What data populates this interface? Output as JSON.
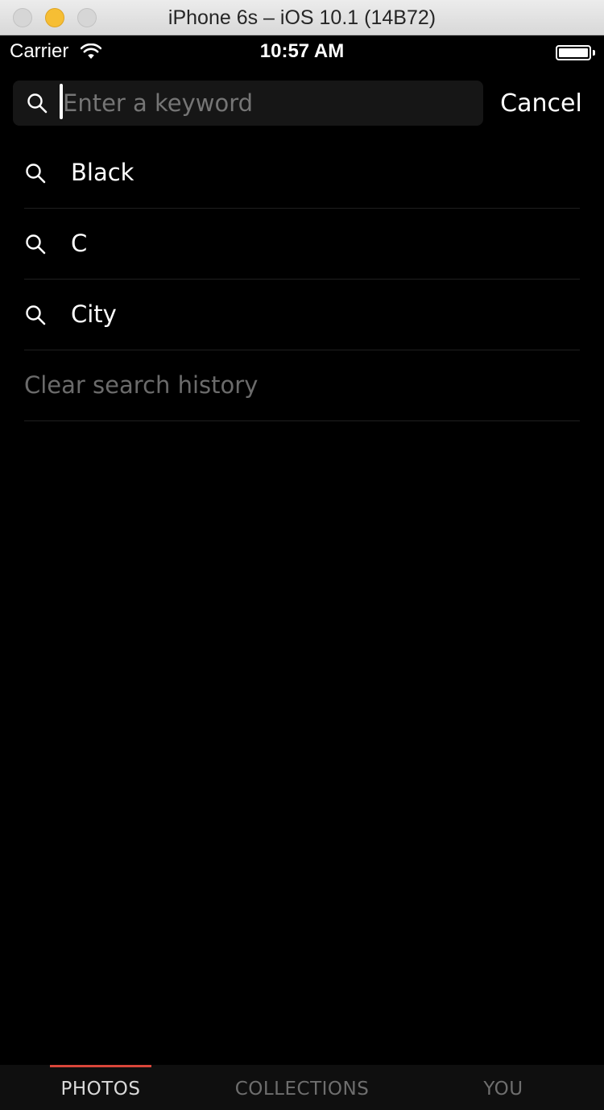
{
  "window": {
    "title": "iPhone 6s – iOS 10.1 (14B72)"
  },
  "status_bar": {
    "carrier": "Carrier",
    "time": "10:57 AM",
    "wifi_icon": "wifi-icon",
    "battery_icon": "battery-icon",
    "battery_level": 1.0
  },
  "search": {
    "placeholder": "Enter a keyword",
    "value": "",
    "icon": "search-icon",
    "cancel_label": "Cancel"
  },
  "history": {
    "items": [
      {
        "label": "Black",
        "icon": "search-icon"
      },
      {
        "label": "C",
        "icon": "search-icon"
      },
      {
        "label": "City",
        "icon": "search-icon"
      }
    ],
    "clear_label": "Clear search history"
  },
  "tabs": [
    {
      "label": "PHOTOS",
      "active": true
    },
    {
      "label": "COLLECTIONS",
      "active": false
    },
    {
      "label": "YOU",
      "active": false
    }
  ],
  "colors": {
    "background": "#000000",
    "accent": "#d9463a",
    "placeholder": "#757575",
    "muted_text": "#6b6b6b"
  }
}
